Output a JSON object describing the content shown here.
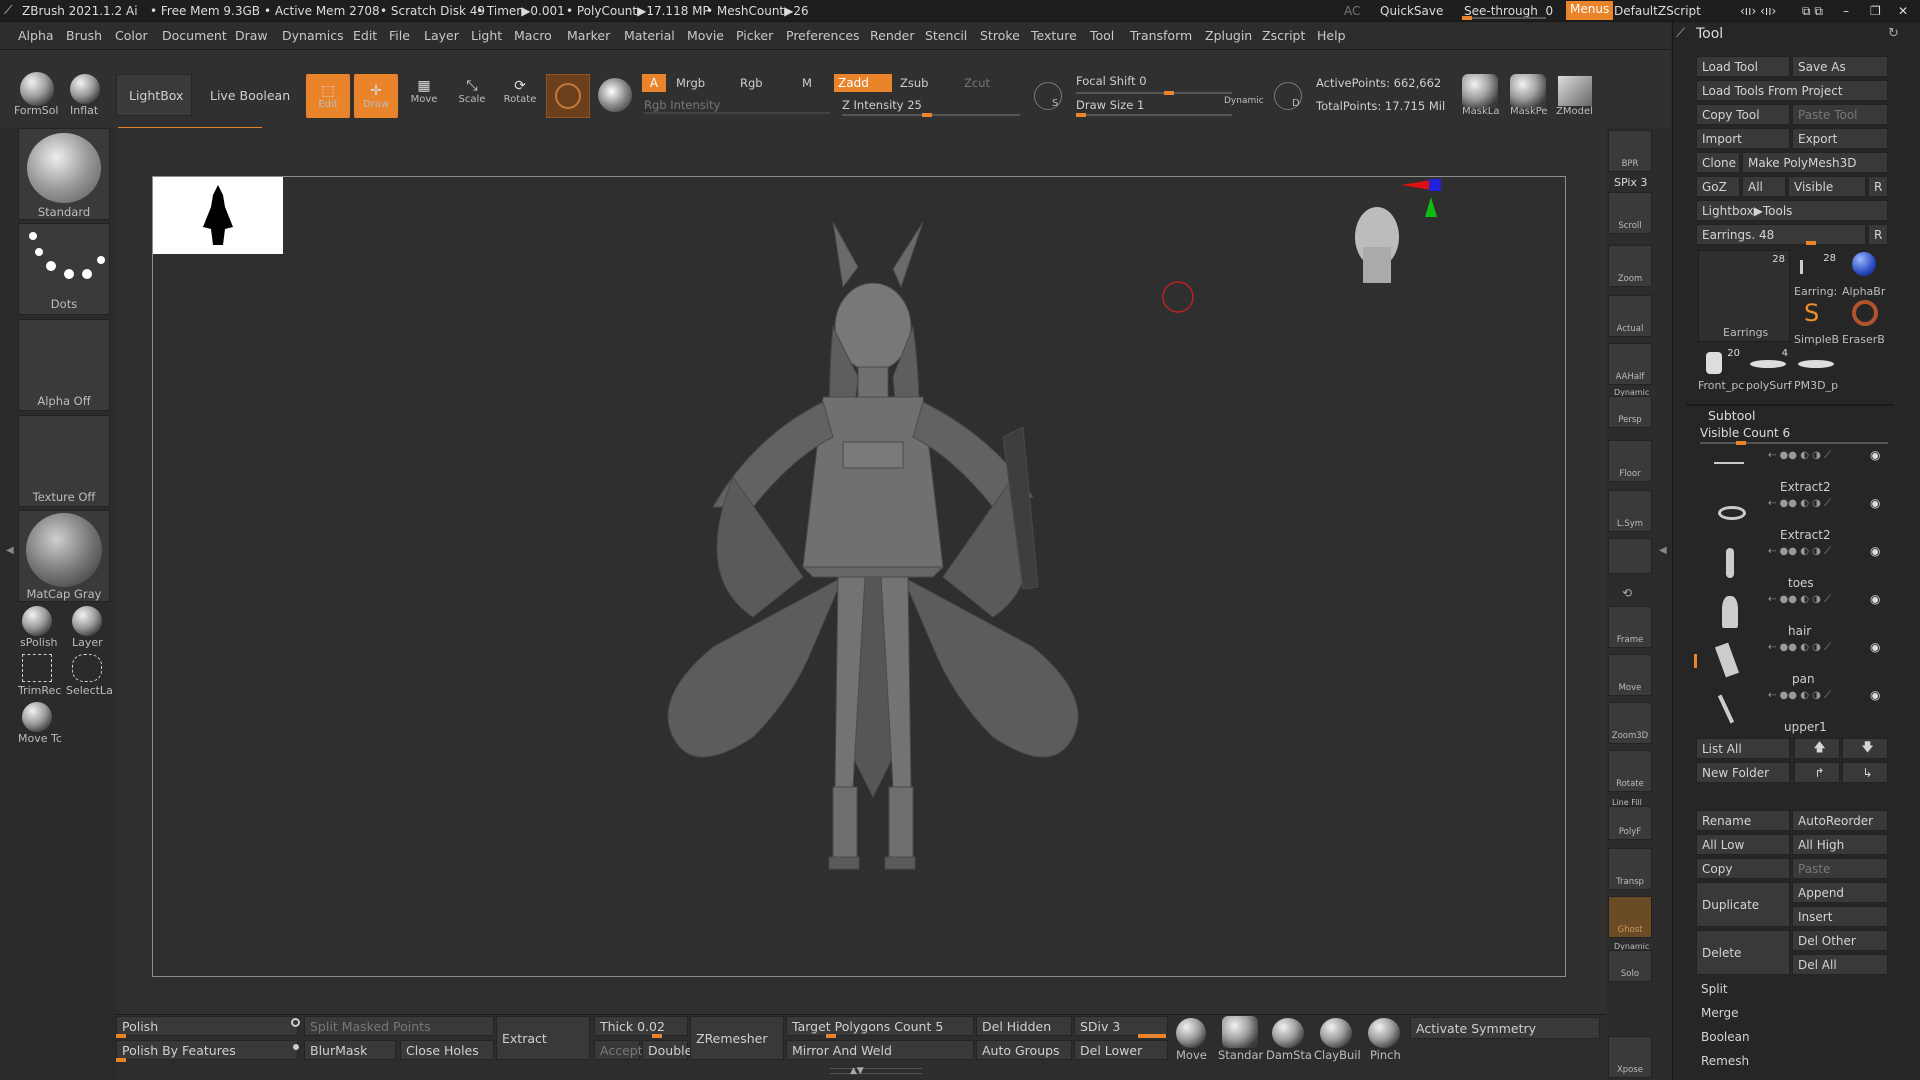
{
  "title_bar": {
    "app": "ZBrush 2021.1.2",
    "ai": "Ai",
    "free_mem": "• Free Mem 9.3GB",
    "active_mem": "• Active Mem 2708",
    "scratch": "• Scratch Disk 49",
    "timer": "• Timer▶0.001",
    "polycount": "• PolyCount▶17.118 MP",
    "meshcount": "• MeshCount▶26",
    "ac": "AC",
    "quicksave": "QuickSave",
    "see_through": "See-through",
    "see_through_value": "0",
    "menus": "Menus",
    "script": "DefaultZScript"
  },
  "menu_bar": [
    "Alpha",
    "Brush",
    "Color",
    "Document",
    "Draw",
    "Dynamics",
    "Edit",
    "File",
    "Layer",
    "Light",
    "Macro",
    "Marker",
    "Material",
    "Movie",
    "Picker",
    "Preferences",
    "Render",
    "Stencil",
    "Stroke",
    "Texture",
    "Tool",
    "Transform",
    "Zplugin",
    "Zscript",
    "Help"
  ],
  "toolbar": {
    "brush1": "FormSol",
    "brush2": "Inflat",
    "lightbox": "LightBox",
    "live_boolean": "Live Boolean",
    "edit": "Edit",
    "draw": "Draw",
    "move": "Move",
    "scale": "Scale",
    "rotate": "Rotate",
    "a": "A",
    "mrgb": "Mrgb",
    "rgb": "Rgb",
    "m": "M",
    "rgb_intensity": "Rgb Intensity",
    "zadd": "Zadd",
    "zsub": "Zsub",
    "zcut": "Zcut",
    "z_intensity": "Z Intensity 25",
    "focal_shift": "Focal Shift 0",
    "draw_size": "Draw Size 1",
    "dynamic": "Dynamic",
    "active_points": "ActivePoints: 662,662",
    "total_points": "TotalPoints: 17.715 Mil",
    "mask1": "MaskLa",
    "mask2": "MaskPe",
    "zmodeler": "ZModel",
    "s_label": "S",
    "d_label": "D"
  },
  "left_shelf": {
    "standard": "Standard",
    "dots": "Dots",
    "alpha_off": "Alpha Off",
    "texture_off": "Texture Off",
    "matcap": "MatCap Gray",
    "spolish": "sPolish",
    "layer": "Layer",
    "trimrec": "TrimRec",
    "selectla": "SelectLa",
    "movetc": "Move Tc"
  },
  "right_shelf": [
    "BPR",
    "SPix 3",
    "Scroll",
    "Zoom",
    "Actual",
    "AAHalf",
    "Persp",
    "Floor",
    "L.Sym",
    "",
    "",
    "Frame",
    "Move",
    "Zoom3D",
    "Rotate",
    "PolyF",
    "Transp",
    "Ghost",
    "Solo",
    "Xpose"
  ],
  "right_shelf_labels_top": {
    "dynamic": "Dynamic",
    "linefill": "Line Fill",
    "dynamic2": "Dynamic"
  },
  "tool_panel": {
    "title": "Tool",
    "load_tool": "Load Tool",
    "save_as": "Save As",
    "load_from_project": "Load Tools From Project",
    "copy_tool": "Copy Tool",
    "paste_tool": "Paste Tool",
    "import": "Import",
    "export": "Export",
    "clone": "Clone",
    "make_polymesh": "Make PolyMesh3D",
    "goz": "GoZ",
    "all": "All",
    "visible": "Visible",
    "r": "R",
    "lightbox_tools": "Lightbox▶Tools",
    "earrings_slider": "Earrings. 48",
    "r2": "R",
    "thumb1_label": "Earrings",
    "thumb1_count": "28",
    "thumb2_label": "Earring:",
    "thumb2_count": "28",
    "thumb3_label": "AlphaBr",
    "thumb4_label": "SimpleB",
    "thumb5_label": "EraserB",
    "thumb6_label": "Front_pc",
    "thumb6_count": "20",
    "thumb7_label": "polySurf",
    "thumb7_count": "4",
    "thumb8_label": "PM3D_p",
    "subtool": "Subtool",
    "visible_count": "Visible Count 6",
    "subtools": [
      "Extract2",
      "Extract2",
      "toes",
      "hair",
      "pan",
      "upper1"
    ],
    "list_all": "List All",
    "new_folder": "New Folder",
    "rename": "Rename",
    "autoreorder": "AutoReorder",
    "all_low": "All Low",
    "all_high": "All High",
    "copy": "Copy",
    "paste": "Paste",
    "duplicate": "Duplicate",
    "append": "Append",
    "insert": "Insert",
    "delete": "Delete",
    "del_other": "Del Other",
    "del_all": "Del All",
    "split": "Split",
    "merge": "Merge",
    "boolean": "Boolean",
    "remesh": "Remesh"
  },
  "bottom_bar": {
    "polish": "Polish",
    "polish_by_features": "Polish By Features",
    "split_masked": "Split Masked Points",
    "blurmask": "BlurMask",
    "close_holes": "Close Holes",
    "extract": "Extract",
    "thick": "Thick 0.02",
    "accept": "Accept",
    "double": "Double",
    "zremesher": "ZRemesher",
    "target_polygons": "Target Polygons Count 5",
    "mirror_weld": "Mirror And Weld",
    "del_hidden": "Del Hidden",
    "auto_groups": "Auto Groups",
    "sdiv": "SDiv 3",
    "del_lower": "Del Lower",
    "brushes": [
      "Move",
      "Standar",
      "DamSta",
      "ClayBuil",
      "Pinch"
    ],
    "activate_symmetry": "Activate Symmetry"
  },
  "colors": {
    "accent": "#e9842b",
    "bg": "#2a2a2a"
  }
}
